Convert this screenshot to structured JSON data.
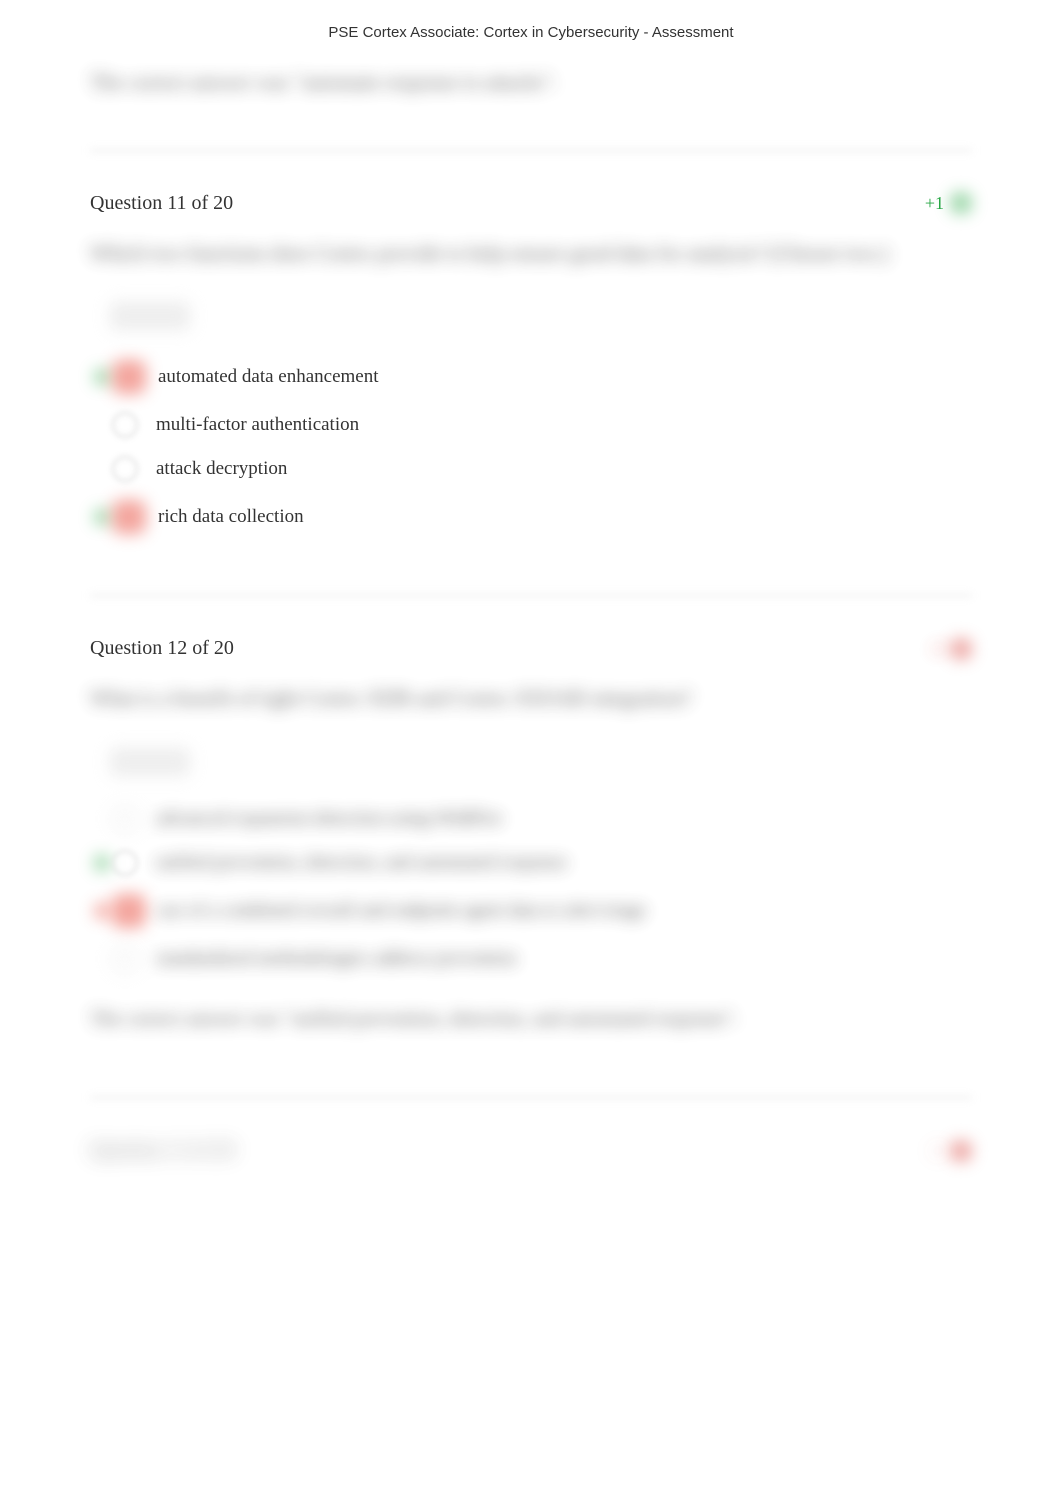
{
  "header": {
    "title": "PSE Cortex Associate: Cortex in Cybersecurity - Assessment"
  },
  "prev_feedback": "The correct answer was \"automate response to attacks\".",
  "question11": {
    "number": "Question 11 of 20",
    "score": "+1",
    "prompt": "Which two functions does Cortex provide to help ensure good data for analysis? (Choose two.)",
    "options": {
      "a": "automated data enhancement",
      "b": "multi-factor authentication",
      "c": "attack decryption",
      "d": "rich data collection"
    }
  },
  "question12": {
    "number": "Question 12 of 20",
    "score": "-1",
    "prompt": "What is a benefit of tight Cortex XDR and Cortex XSOAR integration?",
    "options": {
      "a": "advanced expansion detection using WildFire",
      "b": "unified prevention, detection, and automated response",
      "c": "use of a combined overall and endpoint agent data to alert triage",
      "d": "standardized methodologies address prevention"
    },
    "feedback": "The correct answer was \"unified prevention, detection, and automated response\"."
  },
  "question13": {
    "number": "Question 13 of 20",
    "score": "-1"
  }
}
